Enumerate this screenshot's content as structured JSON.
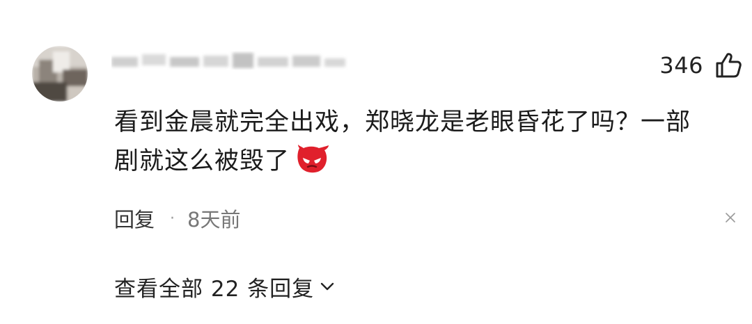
{
  "comment": {
    "like_count": "346",
    "text_line1": "看到金晨就完全出戏，郑晓龙是老眼昏花了吗？一部",
    "text_line2": "剧就这么被毁了",
    "reply_label": "回复",
    "separator": "·",
    "time_ago": "8天前",
    "view_replies_label": "查看全部 22 条回复"
  },
  "icons": {
    "like": "thumbs-up-icon",
    "emoji": "angry-red-face-emoji-icon",
    "close": "close-icon",
    "expand": "chevron-down-icon"
  },
  "colors": {
    "text": "#1b1b1b",
    "secondary_text": "#777777",
    "emoji_red": "#e0202c"
  }
}
